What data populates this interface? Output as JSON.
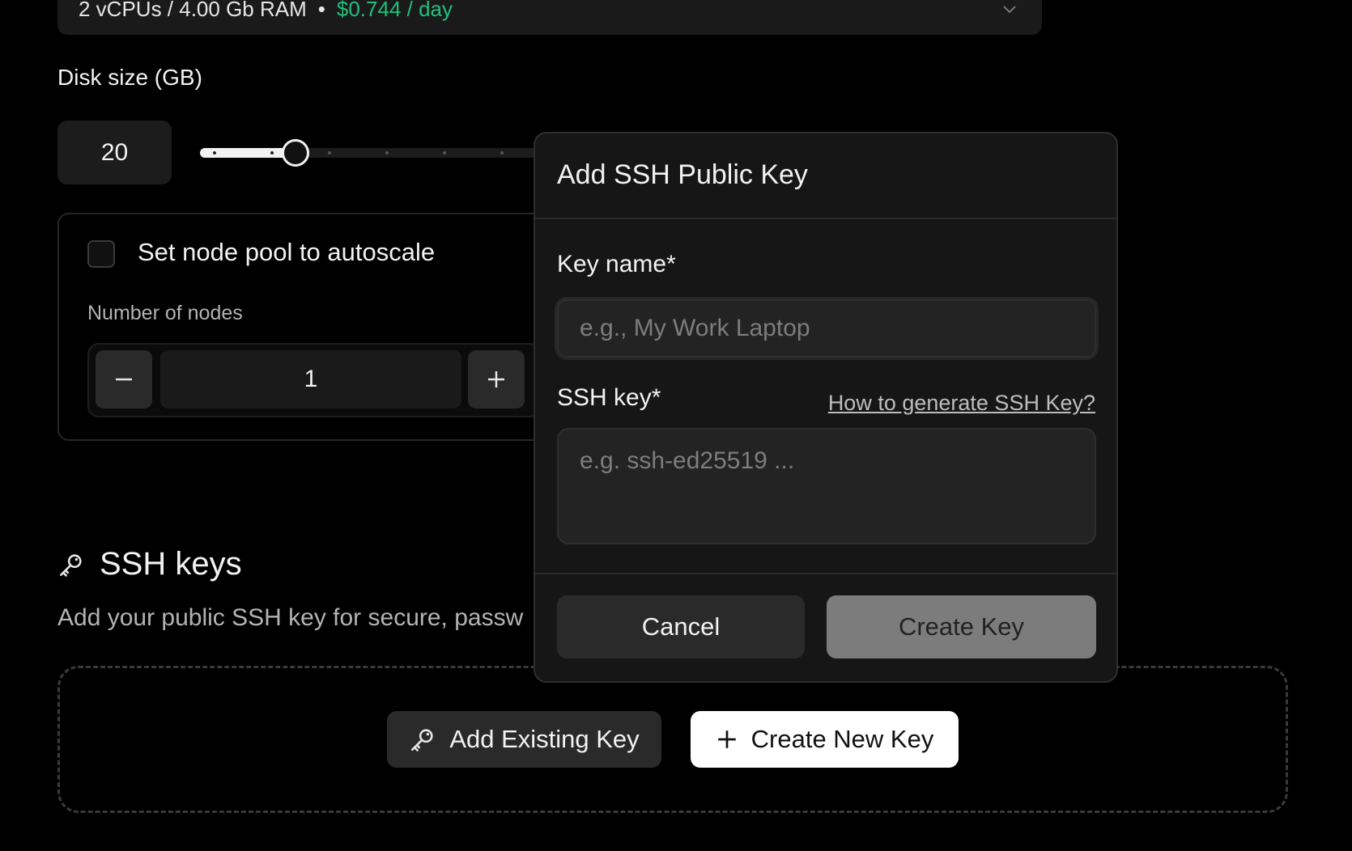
{
  "machine": {
    "spec": "2 vCPUs / 4.00 Gb RAM",
    "separator": "•",
    "price": "$0.744 / day",
    "price_color": "#1fc07a",
    "chevron_icon": "chevron-down-icon"
  },
  "disk": {
    "label": "Disk size (GB)",
    "value": "20"
  },
  "autoscale": {
    "label": "Set node pool to autoscale",
    "checked": false,
    "nodes_label": "Number of nodes",
    "nodes_value": "1",
    "decrement_icon": "minus-icon",
    "increment_icon": "plus-icon"
  },
  "ssh": {
    "heading": "SSH keys",
    "heading_icon": "key-icon",
    "subtitle": "Add your public SSH key for secure, passw",
    "add_existing_label": "Add Existing Key",
    "create_new_label": "Create New Key"
  },
  "modal": {
    "title": "Add SSH Public Key",
    "key_name_label": "Key name*",
    "key_name_placeholder": "e.g., My Work Laptop",
    "ssh_key_label": "SSH key*",
    "help_link": "How to generate SSH Key?",
    "ssh_key_placeholder": "e.g. ssh-ed25519 ...",
    "cancel_label": "Cancel",
    "create_label": "Create Key"
  }
}
